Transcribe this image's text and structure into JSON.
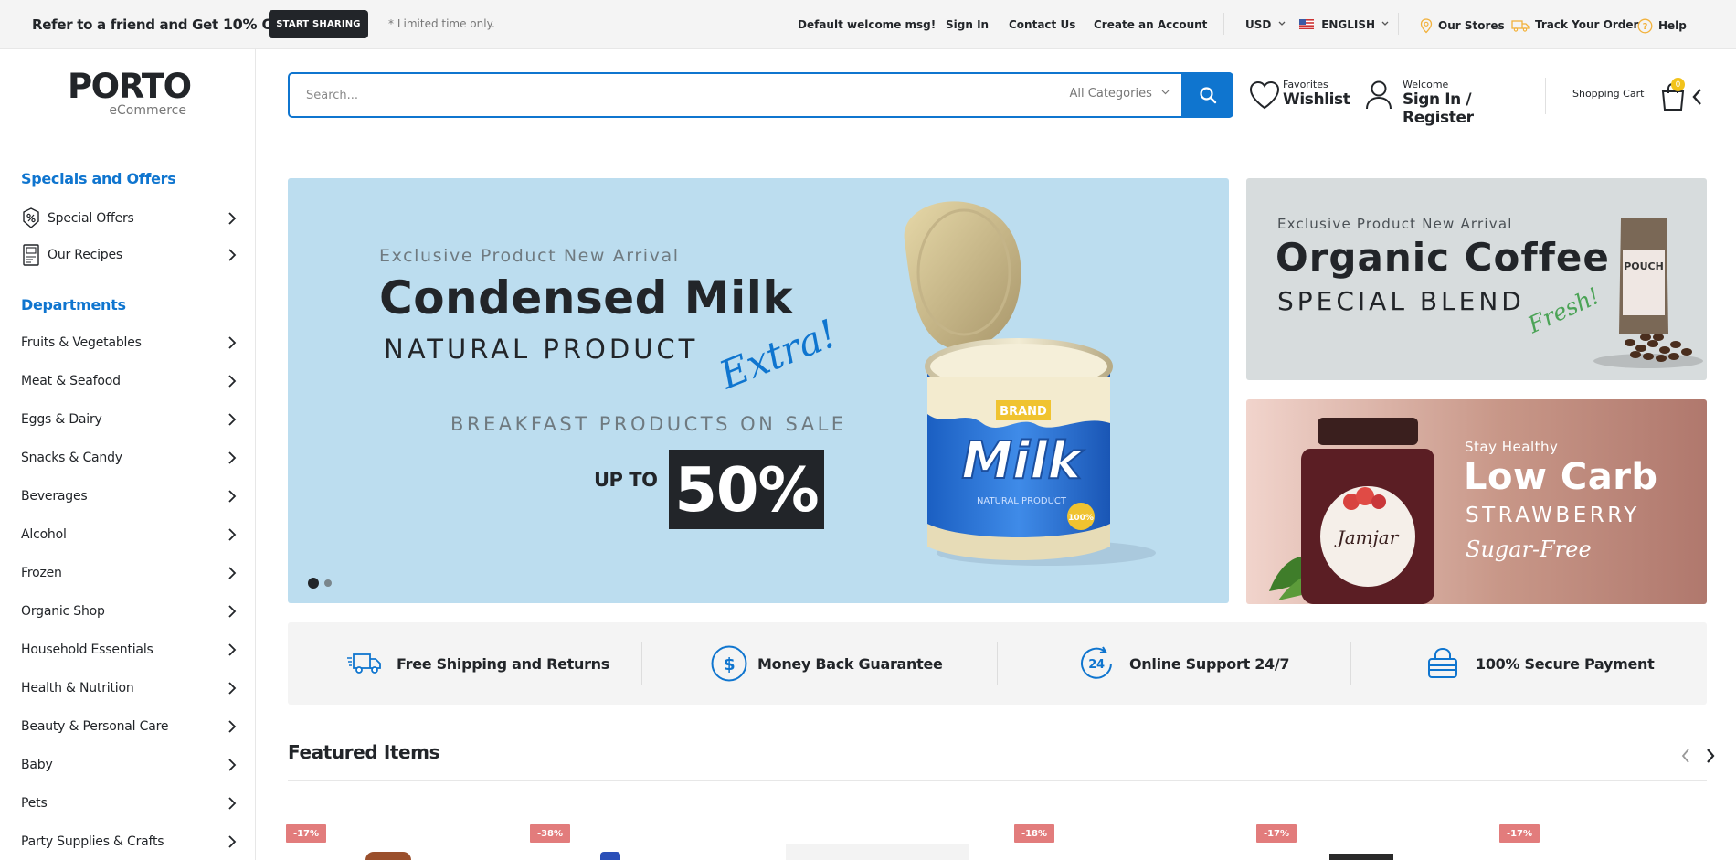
{
  "topbar": {
    "promo_prefix": "Refer to a friend and Get",
    "promo_highlight": "10% OFF",
    "share_button": "START SHARING",
    "limited_note": "* Limited time only.",
    "welcome": "Default welcome msg!",
    "sign_in": "Sign In",
    "contact": "Contact Us",
    "create_account": "Create an Account",
    "currency": "USD",
    "language": "ENGLISH",
    "stores": "Our Stores",
    "track": "Track Your Order",
    "help": "Help"
  },
  "logo": {
    "main": "PORTO",
    "sub": "eCommerce"
  },
  "search": {
    "placeholder": "Search...",
    "category": "All Categories"
  },
  "header": {
    "wishlist_small": "Favorites",
    "wishlist_big": "Wishlist",
    "account_small": "Welcome",
    "account_big": "Sign In / Register",
    "cart_label": "Shopping Cart",
    "cart_count": "0"
  },
  "sidebar": {
    "specials_heading": "Specials and Offers",
    "specials": [
      {
        "label": "Special Offers",
        "icon": "percent-tag-icon"
      },
      {
        "label": "Our Recipes",
        "icon": "recipe-book-icon"
      }
    ],
    "departments_heading": "Departments",
    "departments": [
      "Fruits & Vegetables",
      "Meat & Seafood",
      "Eggs & Dairy",
      "Snacks & Candy",
      "Beverages",
      "Alcohol",
      "Frozen",
      "Organic Shop",
      "Household Essentials",
      "Health & Nutrition",
      "Beauty & Personal Care",
      "Baby",
      "Pets",
      "Party Supplies & Crafts"
    ]
  },
  "hero": {
    "kicker": "Exclusive Product New Arrival",
    "title": "Condensed Milk",
    "subtitle": "NATURAL PRODUCT",
    "script": "Extra!",
    "sale_line": "BREAKFAST PRODUCTS ON SALE",
    "up_to": "UP TO",
    "percent": "50%",
    "can_brand": "BRAND",
    "can_name": "Milk",
    "can_sub": "NATURAL PRODUCT",
    "can_seal": "100%",
    "slides": 2,
    "active_slide": 1
  },
  "banner_coffee": {
    "kicker": "Exclusive Product New Arrival",
    "title": "Organic Coffee",
    "subtitle": "SPECIAL BLEND",
    "script": "Fresh!",
    "pouch_label": "POUCH"
  },
  "banner_jam": {
    "kicker": "Stay Healthy",
    "title": "Low Carb",
    "subtitle": "STRAWBERRY",
    "script": "Sugar-Free",
    "jar_label": "Jamjar"
  },
  "features": [
    {
      "label": "Free Shipping and Returns",
      "icon": "truck-icon"
    },
    {
      "label": "Money Back Guarantee",
      "icon": "dollar-circle-icon"
    },
    {
      "label": "Online Support 24/7",
      "icon": "support-24-icon"
    },
    {
      "label": "100% Secure Payment",
      "icon": "secure-payment-icon"
    }
  ],
  "featured": {
    "title": "Featured Items",
    "badges": [
      "-17%",
      "-38%",
      "-18%",
      "-17%",
      "-17%"
    ]
  },
  "colors": {
    "accent": "#0f75cf",
    "dark": "#222529",
    "sale_badge": "#e27c7c",
    "hero_bg": "#bcddef",
    "cart_count_bg": "#f2c31b"
  }
}
